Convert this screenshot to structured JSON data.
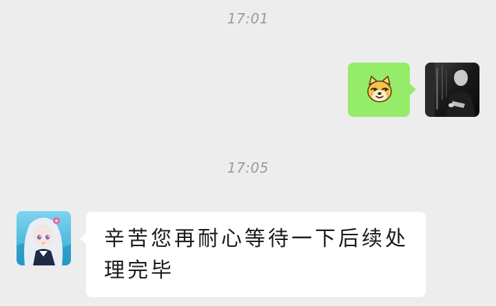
{
  "chat": {
    "messages": [
      {
        "timestamp": "17:01",
        "sender": "me",
        "type": "sticker",
        "sticker": "shiba-doge-emoji",
        "avatar": "dark-photo-avatar"
      },
      {
        "timestamp": "17:05",
        "sender": "other",
        "type": "text",
        "text": "辛苦您再耐心等待一下后续处理完毕",
        "avatar": "anime-girl-avatar"
      }
    ]
  },
  "colors": {
    "background": "#ededed",
    "sent_bubble": "#95ec69",
    "received_bubble": "#ffffff",
    "timestamp_text": "#9a9a9a"
  }
}
